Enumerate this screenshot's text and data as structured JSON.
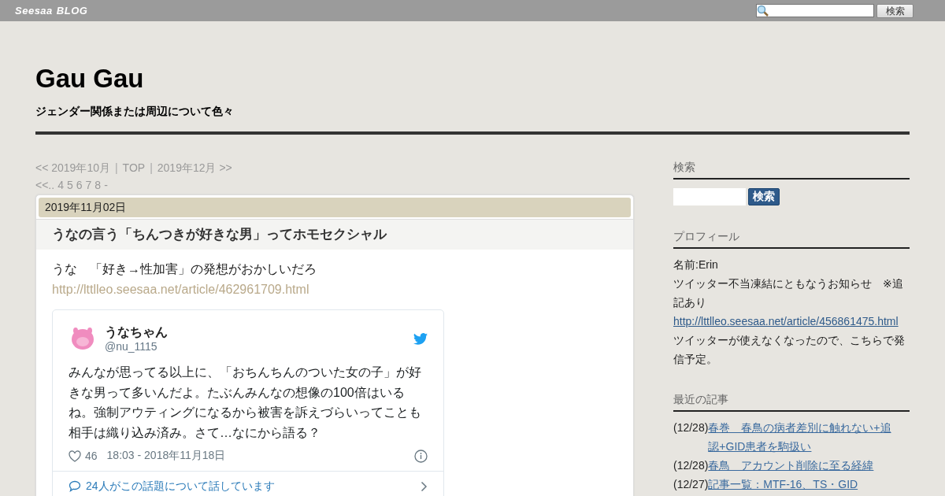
{
  "top_bar": {
    "logo": [
      "Seesaa",
      "BLOG"
    ],
    "search_button": "検索"
  },
  "blog": {
    "title": "Gau Gau",
    "subtitle": "ジェンダー関係または周辺について色々"
  },
  "nav": [
    {
      "kind": "link",
      "text": "<< 2019年10月"
    },
    {
      "kind": "separator",
      "text": "|"
    },
    {
      "kind": "link",
      "text": "TOP"
    },
    {
      "kind": "separator",
      "text": "|"
    },
    {
      "kind": "link",
      "text": "2019年12月 >>"
    }
  ],
  "pager": [
    "<<..",
    "4",
    "5",
    "6",
    "7",
    "8",
    "-"
  ],
  "article": {
    "date": "2019年11月02日",
    "title": "うなの言う「ちんつきが好きな男」ってホモセクシャル",
    "lead": "うな　「好き→性加害」の発想がおかしいだろ",
    "link": "http://lttlleo.seesaa.net/article/462961709.html",
    "tweet": {
      "name": "うなちゃん",
      "handle": "@nu_1115",
      "text": "みんなが思ってる以上に、「おちんちんのついた女の子」が好きな男って多いんだよ。たぶんみんなの想像の100倍はいるね。強制アウティングになるから被害を訴えづらいってことも相手は織り込み済み。さて…なにから語る？",
      "likes": "46",
      "time": "18:03 - 2018年11月18日",
      "replies": "24人がこの話題について話しています"
    }
  },
  "sidebar": [
    {
      "kind": "search",
      "heading": "検索",
      "button": "検索"
    },
    {
      "kind": "profile",
      "heading": "プロフィール",
      "lines": [
        {
          "kind": "text",
          "text": "名前:Erin"
        },
        {
          "kind": "text",
          "text": "ツイッター不当凍結にともなうお知らせ　※追記あり"
        },
        {
          "kind": "link",
          "text": "http://lttlleo.seesaa.net/article/456861475.html"
        },
        {
          "kind": "text",
          "text": "ツイッターが使えなくなったので、こちらで発信予定。"
        }
      ]
    },
    {
      "kind": "recent",
      "heading": "最近の記事",
      "items": [
        {
          "date": "(12/28)",
          "title": "春巻　春鳥の病者差別に触れない+追認+GID患者を駒扱い"
        },
        {
          "date": "(12/28)",
          "title": "春鳥　アカウント削除に至る経緯"
        },
        {
          "date": "(12/27)",
          "title": "記事一覧：MTF-16、TS・GID"
        }
      ]
    }
  ]
}
